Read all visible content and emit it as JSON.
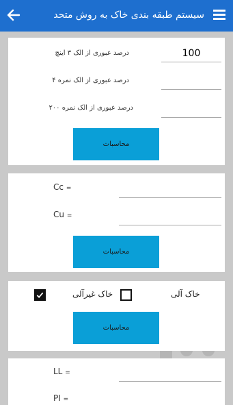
{
  "appbar": {
    "title": "سیستم طبقه بندی خاک به روش متحد",
    "back_icon": "arrow-left-icon",
    "menu_icon": "hamburger-icon"
  },
  "passing_card": {
    "inch3_label": "درصد عبوری از الک ۳ اینچ",
    "inch3_value": "100",
    "no4_label": "درصد عبوری از الک نمره ۴",
    "no4_value": "",
    "no200_label": "درصد عبوری از الک نمره ۲۰۰",
    "no200_value": "",
    "calc_label": "محاسبات"
  },
  "coeff_card": {
    "cc_label": "Cc",
    "cc_eq": "=",
    "cc_value": "",
    "cu_label": "Cu",
    "cu_eq": "=",
    "cu_value": "",
    "calc_label": "محاسبات"
  },
  "soil_card": {
    "organic_label": "خاک آلی",
    "inorganic_label": "خاک غیرآلی",
    "inorganic_checked": false,
    "extra_checked": true,
    "calc_label": "محاسبات"
  },
  "limits_card": {
    "ll_label": "LL",
    "ll_eq": "=",
    "ll_value": "",
    "pl_label": "PI",
    "pl_eq": "=",
    "pl_value": ""
  },
  "colors": {
    "appbar": "#1e6fcf",
    "button": "#0a9fd7",
    "background": "#c9c9c9"
  }
}
